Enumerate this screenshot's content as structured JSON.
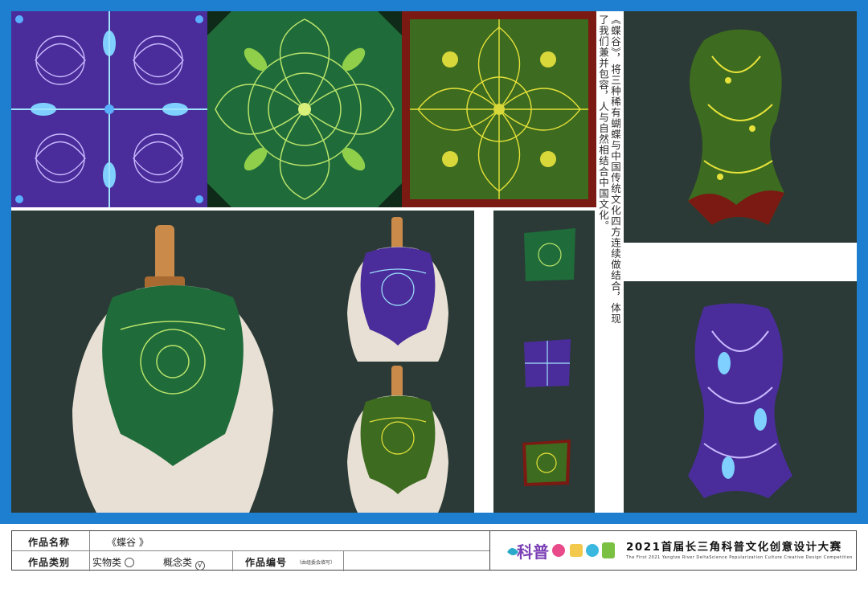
{
  "description_text": "《蝶谷》，将三种稀有蝴蝶与中国传统文化四方连续做结合，体现了我们兼并包容，人与自然相结合中国文化。",
  "footer": {
    "name_label": "作品名称",
    "name_value": "《蝶谷 》",
    "category_label": "作品类别",
    "category_physical": "实物类",
    "category_concept": "概念类",
    "check_mark": "√",
    "number_label": "作品编号",
    "number_note": "（由组委会填写）"
  },
  "contest": {
    "logo_text": "科普",
    "title": "2021首届长三角科普文化创意设计大赛",
    "subtitle": "The First 2021 Yangtze River DeltaScience Popularization Culture Creative Design Competition"
  },
  "colors": {
    "frame_blue": "#1e7fd0",
    "panel_dark": "#2b3a36",
    "purple": "#4a2d9a",
    "green": "#1f6b3a",
    "olive": "#3d6b1f",
    "lime": "#b8d43a",
    "maroon": "#7a1a12"
  }
}
